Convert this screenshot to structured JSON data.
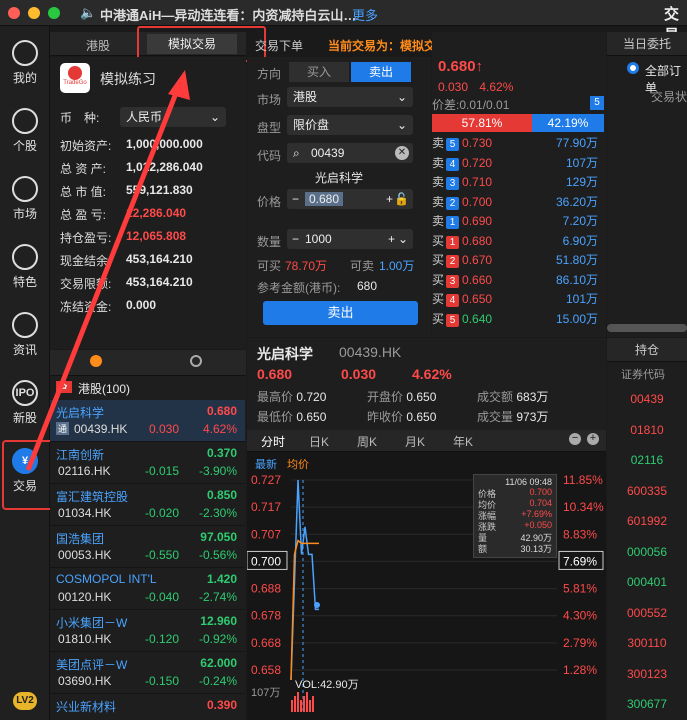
{
  "topbar": {
    "ticker": "中港通AiH—异动连连看：内资减持白云山…",
    "more": "更多",
    "right_title": "交易"
  },
  "sidebar": [
    {
      "label": "我的",
      "icon": "avatar-icon"
    },
    {
      "label": "个股",
      "icon": "chart-bars-icon"
    },
    {
      "label": "市场",
      "icon": "trend-line-icon"
    },
    {
      "label": "特色",
      "icon": "sliders-icon"
    },
    {
      "label": "资讯",
      "icon": "news-icon"
    },
    {
      "label": "新股",
      "icon": "ipo-icon",
      "glyph": "IPO"
    },
    {
      "label": "交易",
      "icon": "yen-icon",
      "glyph": "¥"
    }
  ],
  "sidebar_bottom": "LV2",
  "tabs": {
    "hk": "港股",
    "sim": "模拟交易",
    "trade": "交易下单",
    "current_prefix": "当前交易为：",
    "current_value": "模拟交易",
    "today_orders": "当日委托"
  },
  "account": {
    "title": "模拟练习",
    "logo_text": "TradeGo",
    "currency_label": "币　种:",
    "currency": "人民币",
    "rows": [
      {
        "label": "初始资产:",
        "value": "1,000,000.000",
        "cls": "white"
      },
      {
        "label": "总 资 产:",
        "value": "1,012,286.040",
        "cls": "white"
      },
      {
        "label": "总 市 值:",
        "value": "559,121.830",
        "cls": "white"
      },
      {
        "label": "总 盈 亏:",
        "value": "12,286.040",
        "cls": "red"
      },
      {
        "label": "持仓盈亏:",
        "value": "12,065.808",
        "cls": "red"
      },
      {
        "label": "现金结余:",
        "value": "453,164.210",
        "cls": "white"
      },
      {
        "label": "交易限额:",
        "value": "453,164.210",
        "cls": "white"
      },
      {
        "label": "冻结资金:",
        "value": "0.000",
        "cls": "white"
      }
    ]
  },
  "order": {
    "direction_label": "方向",
    "buy": "买入",
    "sell": "卖出",
    "market_label": "市场",
    "market": "港股",
    "type_label": "盘型",
    "type": "限价盘",
    "code_label": "代码",
    "code": "00439",
    "name": "光启科学",
    "price_label": "价格",
    "price": "0.680",
    "qty_label": "数量",
    "qty": "1000",
    "can_buy_label": "可买",
    "can_buy": "78.70万",
    "can_sell_label": "可卖",
    "can_sell": "1.00万",
    "ref_label": "参考金额(港币):",
    "ref": "680",
    "submit": "卖出"
  },
  "quote": {
    "price": "0.680",
    "arrow": "↑",
    "chg": "0.030",
    "pct": "4.62%",
    "spread_label": "价差:",
    "spread": "0.01/0.01",
    "spread_badge": "5",
    "bid_pct": "57.81%",
    "ask_pct": "42.19%",
    "asks": [
      {
        "side": "卖",
        "n": "5",
        "price": "0.730",
        "vol": "77.90万",
        "cls": "red"
      },
      {
        "side": "卖",
        "n": "4",
        "price": "0.720",
        "vol": "107万",
        "cls": "red"
      },
      {
        "side": "卖",
        "n": "3",
        "price": "0.710",
        "vol": "129万",
        "cls": "red"
      },
      {
        "side": "卖",
        "n": "2",
        "price": "0.700",
        "vol": "36.20万",
        "cls": "red"
      },
      {
        "side": "卖",
        "n": "1",
        "price": "0.690",
        "vol": "7.20万",
        "cls": "red"
      }
    ],
    "bids": [
      {
        "side": "买",
        "n": "1",
        "price": "0.680",
        "vol": "6.90万",
        "cls": "red"
      },
      {
        "side": "买",
        "n": "2",
        "price": "0.670",
        "vol": "51.80万",
        "cls": "red"
      },
      {
        "side": "买",
        "n": "3",
        "price": "0.660",
        "vol": "86.10万",
        "cls": "red"
      },
      {
        "side": "买",
        "n": "4",
        "price": "0.650",
        "vol": "101万",
        "cls": "red"
      },
      {
        "side": "买",
        "n": "5",
        "price": "0.640",
        "vol": "15.00万",
        "cls": "green"
      }
    ]
  },
  "detail": {
    "name": "光启科学",
    "code": "00439.HK",
    "price": "0.680",
    "chg": "0.030",
    "pct": "4.62%",
    "high_label": "最高价",
    "high": "0.720",
    "open_label": "开盘价",
    "open": "0.650",
    "amount_label": "成交额",
    "amount": "683万",
    "low_label": "最低价",
    "low": "0.650",
    "prev_label": "昨收价",
    "prev": "0.650",
    "vol_label": "成交量",
    "vol": "973万"
  },
  "chart_tabs": [
    "分时",
    "日K",
    "周K",
    "月K",
    "年K"
  ],
  "chart": {
    "legend_latest": "最新",
    "legend_avg": "均价",
    "left_ticks": [
      "0.727",
      "0.717",
      "0.707",
      "0.700",
      "0.688",
      "0.678",
      "0.668",
      "0.658"
    ],
    "right_ticks": [
      "11.85%",
      "10.34%",
      "8.83%",
      "7.69%",
      "5.81%",
      "4.30%",
      "2.79%",
      "1.28%"
    ],
    "vol_label": "107万",
    "vol_text": "VOL:42.90万",
    "tooltip": {
      "time": "11/06 09:48",
      "rows": [
        {
          "k": "价格",
          "v": "0.700"
        },
        {
          "k": "均价",
          "v": "0.704"
        },
        {
          "k": "涨幅",
          "v": "+7.69%"
        },
        {
          "k": "涨跌",
          "v": "+0.050"
        },
        {
          "k": "量",
          "v": "42.90万"
        },
        {
          "k": "额",
          "v": "30.13万"
        }
      ]
    }
  },
  "chart_data": {
    "type": "line",
    "title": "",
    "xlabel": "",
    "ylabel": "",
    "ylim": [
      0.658,
      0.727
    ],
    "series": [
      {
        "name": "最新",
        "values": [
          0.65,
          0.69,
          0.727,
          0.7,
          0.71,
          0.7,
          0.7,
          0.68,
          0.68
        ]
      },
      {
        "name": "均价",
        "values": [
          0.65,
          0.7,
          0.705,
          0.704,
          0.704,
          0.704,
          0.704,
          0.704,
          0.704
        ]
      }
    ]
  },
  "watchlist": {
    "tab_flag": "港股",
    "title": "港股(100)",
    "items": [
      {
        "name": "光启科学",
        "code": "00439.HK",
        "price": "0.680",
        "chg": "0.030",
        "pct": "4.62%",
        "cls": "red",
        "tag": "通"
      },
      {
        "name": "江南创新",
        "code": "02116.HK",
        "price": "0.370",
        "chg": "-0.015",
        "pct": "-3.90%",
        "cls": "green"
      },
      {
        "name": "富汇建筑控股",
        "code": "01034.HK",
        "price": "0.850",
        "chg": "-0.020",
        "pct": "-2.30%",
        "cls": "green"
      },
      {
        "name": "国浩集团",
        "code": "00053.HK",
        "price": "97.050",
        "chg": "-0.550",
        "pct": "-0.56%",
        "cls": "green"
      },
      {
        "name": "COSMOPOL INT'L",
        "code": "00120.HK",
        "price": "1.420",
        "chg": "-0.040",
        "pct": "-2.74%",
        "cls": "green"
      },
      {
        "name": "小米集团－W",
        "code": "01810.HK",
        "price": "12.960",
        "chg": "-0.120",
        "pct": "-0.92%",
        "cls": "green"
      },
      {
        "name": "美团点评－W",
        "code": "03690.HK",
        "price": "62.000",
        "chg": "-0.150",
        "pct": "-0.24%",
        "cls": "green"
      },
      {
        "name": "兴业新材料",
        "code": "",
        "price": "0.390",
        "chg": "",
        "pct": "",
        "cls": "red"
      }
    ]
  },
  "right": {
    "all_orders": "全部订单",
    "order_status": "交易状",
    "positions": "持仓",
    "code_header": "证券代码",
    "codes": [
      {
        "c": "00439",
        "cls": "red"
      },
      {
        "c": "01810",
        "cls": "red"
      },
      {
        "c": "02116",
        "cls": "green"
      },
      {
        "c": "600335",
        "cls": "red"
      },
      {
        "c": "601992",
        "cls": "red"
      },
      {
        "c": "000056",
        "cls": "green"
      },
      {
        "c": "000401",
        "cls": "green"
      },
      {
        "c": "000552",
        "cls": "red"
      },
      {
        "c": "300110",
        "cls": "red"
      },
      {
        "c": "300123",
        "cls": "red"
      },
      {
        "c": "300677",
        "cls": "green"
      }
    ]
  }
}
